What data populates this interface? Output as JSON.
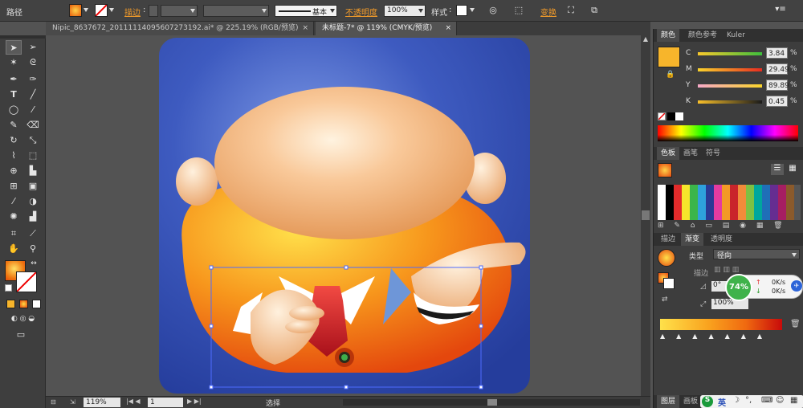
{
  "toolbar": {
    "panel_name": "路径",
    "stroke_label": "描边",
    "stroke_style": "基本",
    "opacity_label": "不透明度",
    "opacity_value": "100%",
    "style_label": "样式",
    "transform_label": "变换"
  },
  "tabs": [
    {
      "label": "Nipic_8637672_20111114095607273192.ai* @ 225.19% (RGB/预览)"
    },
    {
      "label": "未标题-7* @ 119% (CMYK/预览)"
    }
  ],
  "color_panel": {
    "tabs": [
      "颜色",
      "颜色参考",
      "Kuler"
    ],
    "rows": [
      {
        "label": "C",
        "value": "3.84",
        "unit": "%"
      },
      {
        "label": "M",
        "value": "29.49",
        "unit": "%"
      },
      {
        "label": "Y",
        "value": "89.89",
        "unit": "%"
      },
      {
        "label": "K",
        "value": "0.45",
        "unit": "%"
      }
    ]
  },
  "swatch_panel": {
    "tabs": [
      "色板",
      "画笔",
      "符号"
    ]
  },
  "gradient_panel": {
    "tabs": [
      "描边",
      "渐变",
      "透明度"
    ],
    "type_label": "类型",
    "type_value": "径向",
    "stroke_label": "描边",
    "angle_value": "0°",
    "scale_value": "100%"
  },
  "network_widget": {
    "percent": "74%",
    "up": "0K/s",
    "down": "0K/s"
  },
  "statusbar": {
    "zoom": "119%",
    "page": "1",
    "tool": "选择"
  },
  "bottom_right": {
    "tabs": [
      "图层",
      "画板"
    ],
    "ime": "英"
  },
  "colors": {
    "fill": "#f7b52b",
    "canvas_bg": "#3a55b5",
    "accent": "#f09a2a"
  },
  "icons": [
    "selection-icon",
    "direct-select-icon",
    "magic-wand-icon",
    "lasso-icon",
    "pen-icon",
    "type-icon",
    "line-icon",
    "ellipse-icon",
    "brush-icon",
    "pencil-icon",
    "eraser-icon",
    "rotate-icon",
    "scale-icon",
    "warp-icon",
    "gradient-icon",
    "eyedropper-icon",
    "blend-icon",
    "graph-icon",
    "artboard-icon",
    "slice-icon",
    "hand-icon",
    "zoom-icon"
  ]
}
